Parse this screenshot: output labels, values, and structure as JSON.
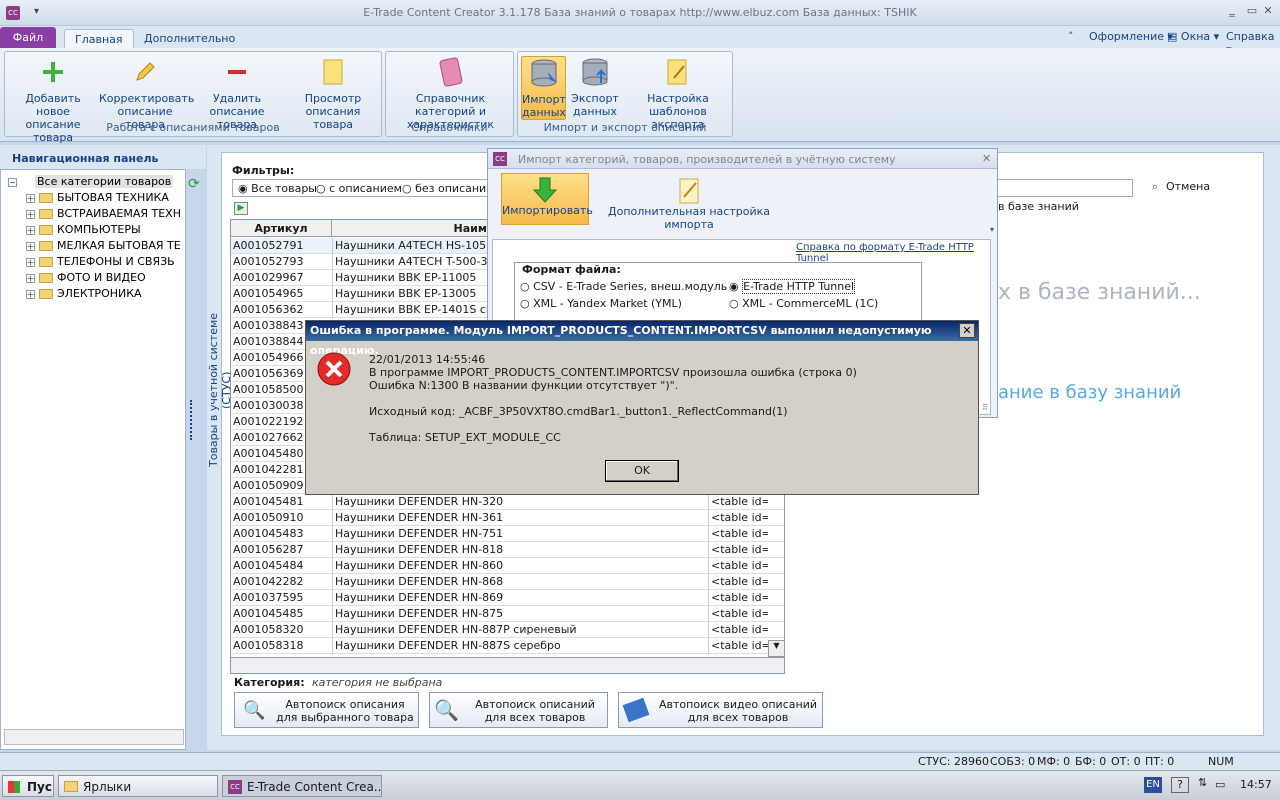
{
  "window": {
    "title": "E-Trade Content Creator 3.1.178    База знаний о товарах    http://www.elbuz.com    База данных: TSHIK",
    "app_icon": "CC",
    "arrow": "▾",
    "min": "‗",
    "max": "▭",
    "close": "✕"
  },
  "tabs": {
    "file": "Файл",
    "home": "Главная",
    "extra": "Дополнительно"
  },
  "menu": {
    "design": "Оформление",
    "windows": "Окна",
    "help": "Справка",
    "chevron": "˄",
    "caret": "▾"
  },
  "ribbon": {
    "g1": {
      "label": "Работа с описаниями товаров",
      "add": "Добавить новое описание товара",
      "edit": "Корректировать описание товара",
      "del": "Удалить описание товара",
      "view": "Просмотр описания товара"
    },
    "g2": {
      "label": "Справочники",
      "catalog": "Справочник категорий и характеристик"
    },
    "g3": {
      "label": "Импорт и экспорт описаний",
      "import": "Импорт данных",
      "export": "Экспорт данных",
      "tpl": "Настройка шаблонов экспорта"
    }
  },
  "nav": {
    "title": "Навигационная панель",
    "root": "Все категории товаров",
    "items": [
      "БЫТОВАЯ ТЕХНИКА",
      "ВСТРАИВАЕМАЯ ТЕХН",
      "КОМПЬЮТЕРЫ",
      "МЕЛКАЯ БЫТОВАЯ ТЕ",
      "ТЕЛЕФОНЫ И СВЯЗЬ",
      "ФОТО И ВИДЕО",
      "ЭЛЕКТРОНИКА"
    ]
  },
  "filters": {
    "label": "Фильтры:",
    "all": "Все товары",
    "with": "с описанием",
    "without": "без описания"
  },
  "side_label": "Товары в учетной системе (СТУС)",
  "grid": {
    "col1": "Артикул",
    "col2": "Наимено",
    "rows": [
      [
        "A001052791",
        "Наушники A4TECH HS-105",
        ""
      ],
      [
        "A001052793",
        "Наушники A4TECH T-500-3 бел",
        ""
      ],
      [
        "A001029967",
        "Наушники BBK EP-11005",
        ""
      ],
      [
        "A001054965",
        "Наушники BBK EP-13005",
        ""
      ],
      [
        "A001056362",
        "Наушники BBK EP-1401S синий",
        ""
      ],
      [
        "A001038843",
        "",
        ""
      ],
      [
        "A001038844",
        "",
        ""
      ],
      [
        "A001054966",
        "",
        ""
      ],
      [
        "A001056369",
        "",
        ""
      ],
      [
        "A001058500",
        "",
        ""
      ],
      [
        "A001030038",
        "",
        ""
      ],
      [
        "A001022192",
        "",
        ""
      ],
      [
        "A001027662",
        "",
        ""
      ],
      [
        "A001045480",
        "",
        ""
      ],
      [
        "A001042281",
        "",
        ""
      ],
      [
        "A001050909",
        "",
        ""
      ],
      [
        "A001045481",
        "Наушники DEFENDER HN-320",
        "<table id="
      ],
      [
        "A001050910",
        "Наушники DEFENDER HN-361",
        "<table id=\"p"
      ],
      [
        "A001045483",
        "Наушники DEFENDER HN-751",
        "<table id=\"p"
      ],
      [
        "A001056287",
        "Наушники DEFENDER HN-818",
        "<table id=\"p"
      ],
      [
        "A001045484",
        "Наушники DEFENDER HN-860",
        "<table id=\"p"
      ],
      [
        "A001042282",
        "Наушники DEFENDER HN-868",
        "<table id=\"p"
      ],
      [
        "A001037595",
        "Наушники DEFENDER HN-869",
        "<table id=\"p"
      ],
      [
        "A001045485",
        "Наушники DEFENDER HN-875",
        "<table id=\"p"
      ],
      [
        "A001058320",
        "Наушники DEFENDER HN-887P сиреневый",
        "<table id=\"p"
      ],
      [
        "A001058318",
        "Наушники DEFENDER HN-887S серебро",
        "<table id=\"p"
      ]
    ]
  },
  "category": {
    "label": "Категория:",
    "value": "категория не выбрана"
  },
  "autosearch": {
    "one": "Автопоиск описания для выбранного товара",
    "all": "Автопоиск описаний для всех товаров",
    "video": "Автопоиск видео описаний для всех товаров"
  },
  "right": {
    "cancel": "Отмена",
    "kb": "в базе знаний",
    "big1": "х в базе знаний...",
    "big2": "ание в базу знаний"
  },
  "import_dialog": {
    "title": "Импорт категорий, товаров, производителей в учётную систему",
    "import": "Импортировать",
    "extra": "Дополнительная настройка импорта",
    "help_link": "Справка по формату E-Trade HTTP Tunnel",
    "format_label": "Формат файла:",
    "csv": "CSV - E-Trade Series, внеш.модуль",
    "tunnel": "E-Trade HTTP Tunnel",
    "yml": "XML - Yandex Market (YML)",
    "cml": "XML - CommerceML (1C)"
  },
  "error": {
    "title": "Ошибка в программе. Модуль IMPORT_PRODUCTS_CONTENT.IMPORTCSV выполнил недопустимую операцию.",
    "date": "22/01/2013 14:55:46",
    "line1": "В программе IMPORT_PRODUCTS_CONTENT.IMPORTCSV произошла ошибка (строка 0)",
    "line2": "Ошибка N:1300 В названии функции отсутствует \")\".",
    "line3": "Исходный код: _ACBF_3P50VXT8O.cmdBar1._button1._ReflectCommand(1)",
    "line4": "Таблица: SETUP_EXT_MODULE_CC",
    "ok": "OK"
  },
  "status": {
    "stus": "СТУС: 28960",
    "sobz": "СОБЗ: 0",
    "mf": "МФ: 0",
    "bf": "БФ: 0",
    "ot": "ОТ: 0",
    "pt": "ПТ: 0",
    "num": "NUM"
  },
  "taskbar": {
    "start": "Пуск",
    "t1": "Ярлыки",
    "t2": "E-Trade Content Crea...",
    "lang": "EN",
    "time": "14:57"
  }
}
